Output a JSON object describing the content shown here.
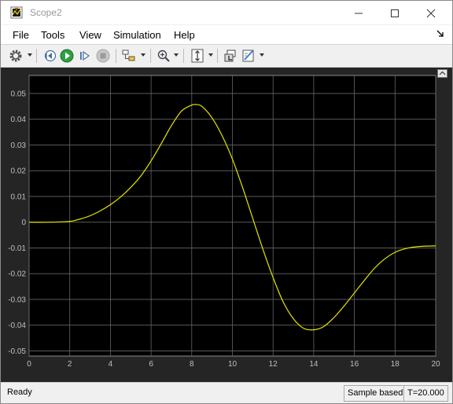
{
  "window": {
    "title": "Scope2"
  },
  "menu": [
    "File",
    "Tools",
    "View",
    "Simulation",
    "Help"
  ],
  "toolbar": {
    "buttons": [
      "settings-icon",
      "step-back-icon",
      "run-icon",
      "step-forward-icon",
      "stop-icon",
      "highlight-block-icon",
      "zoom-icon",
      "scale-axes-icon",
      "restore-layout-icon",
      "style-icon"
    ]
  },
  "colors": {
    "plot_bg": "#000000",
    "frame_bg": "#252525",
    "trace": "#e6e600",
    "grid": "#666666",
    "tick_text": "#bfbfbf"
  },
  "chart_data": {
    "type": "line",
    "title": "",
    "xlabel": "",
    "ylabel": "",
    "xlim": [
      0,
      20
    ],
    "ylim": [
      -0.052,
      0.057
    ],
    "grid": true,
    "xticks": [
      0,
      2,
      4,
      6,
      8,
      10,
      12,
      14,
      16,
      18,
      20
    ],
    "xtick_labels": [
      "0",
      "2",
      "4",
      "6",
      "8",
      "10",
      "12",
      "14",
      "16",
      "18",
      "20"
    ],
    "yticks": [
      0.05,
      0.04,
      0.03,
      0.02,
      0.01,
      0,
      -0.01,
      -0.02,
      -0.03,
      -0.04,
      -0.05
    ],
    "ytick_labels": [
      "0.05",
      "0.04",
      "0.03",
      "0.02",
      "0.01",
      "0",
      "-0.01",
      "-0.02",
      "-0.03",
      "-0.04",
      "-0.05"
    ],
    "series": [
      {
        "x": [
          0,
          1,
          2,
          2.5,
          3,
          3.5,
          4,
          4.5,
          5,
          5.5,
          6,
          6.5,
          7,
          7.5,
          8,
          8.2,
          8.5,
          9,
          9.5,
          10,
          10.5,
          11,
          11.5,
          12,
          12.5,
          13,
          13.5,
          14,
          14.5,
          15,
          15.5,
          16,
          16.5,
          17,
          17.5,
          18,
          18.5,
          19,
          19.5,
          20
        ],
        "y": [
          0,
          0,
          0.0003,
          0.0012,
          0.0025,
          0.0044,
          0.0068,
          0.0098,
          0.0135,
          0.018,
          0.0238,
          0.0305,
          0.0375,
          0.0432,
          0.0455,
          0.0457,
          0.045,
          0.0405,
          0.0335,
          0.0245,
          0.0135,
          0.0015,
          -0.0105,
          -0.0215,
          -0.031,
          -0.0375,
          -0.0412,
          -0.0418,
          -0.0405,
          -0.037,
          -0.0325,
          -0.0275,
          -0.0225,
          -0.0178,
          -0.0142,
          -0.0117,
          -0.0103,
          -0.0096,
          -0.0093,
          -0.0092
        ]
      }
    ]
  },
  "status": {
    "text": "Ready",
    "mode": "Sample based",
    "time": "T=20.000"
  }
}
